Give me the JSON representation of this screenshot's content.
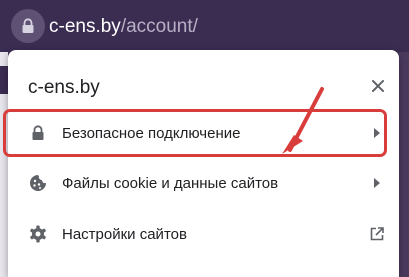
{
  "address_bar": {
    "host": "c-ens.by",
    "path": "/account/"
  },
  "site_info_popup": {
    "title": "c-ens.by",
    "items": [
      {
        "label": "Безопасное подключение",
        "icon": "lock-icon",
        "trailing": "chevron-right-icon"
      },
      {
        "label": "Файлы cookie и данные сайтов",
        "icon": "cookie-icon",
        "trailing": "chevron-right-icon"
      },
      {
        "label": "Настройки сайтов",
        "icon": "gear-icon",
        "trailing": "external-link-icon"
      }
    ]
  },
  "annotation": {
    "color": "#d93d3b",
    "highlighted_item": "Файлы cookie и данные сайтов"
  },
  "colors": {
    "toolbar": "#3b2d52",
    "popup_background": "#ffffff",
    "text": "#202124",
    "icon": "#5f6368"
  }
}
